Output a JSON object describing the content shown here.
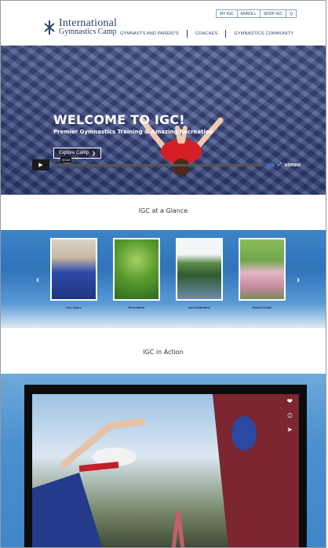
{
  "header": {
    "logo_line1": "International",
    "logo_line2": "Gymnastics Camp",
    "utility": [
      "MY IGC",
      "ENROLL",
      "SHOP IGC",
      "Q"
    ],
    "nav": [
      "GYMNASTS AND PARENTS",
      "COACHES",
      "GYMNASTICS COMMUNITY"
    ]
  },
  "hero": {
    "title": "WELCOME TO IGC!",
    "subtitle": "Premier Gymnastics Training & Amazing Recreation",
    "button_label": "Explore Camp",
    "button_icon": "chevron-right-icon"
  },
  "glance": {
    "title": "IGC at a Glance",
    "prev_icon": "chevron-left-icon",
    "next_icon": "chevron-right-icon",
    "cards": [
      {
        "label": "Our Gyms"
      },
      {
        "label": "Recreation"
      },
      {
        "label": "Accreditations"
      },
      {
        "label": "Parent Guide"
      }
    ]
  },
  "action": {
    "title": "IGC in Action"
  },
  "video": {
    "time": "00:44",
    "brand": "vimeo",
    "side_icons": [
      "heart-icon",
      "clock-icon",
      "send-icon"
    ]
  },
  "colors": {
    "brand_navy": "#28406b",
    "glance_blue": "#2f73b9",
    "hero_blue": "#47558e",
    "gymnast_red": "#d31f25"
  }
}
